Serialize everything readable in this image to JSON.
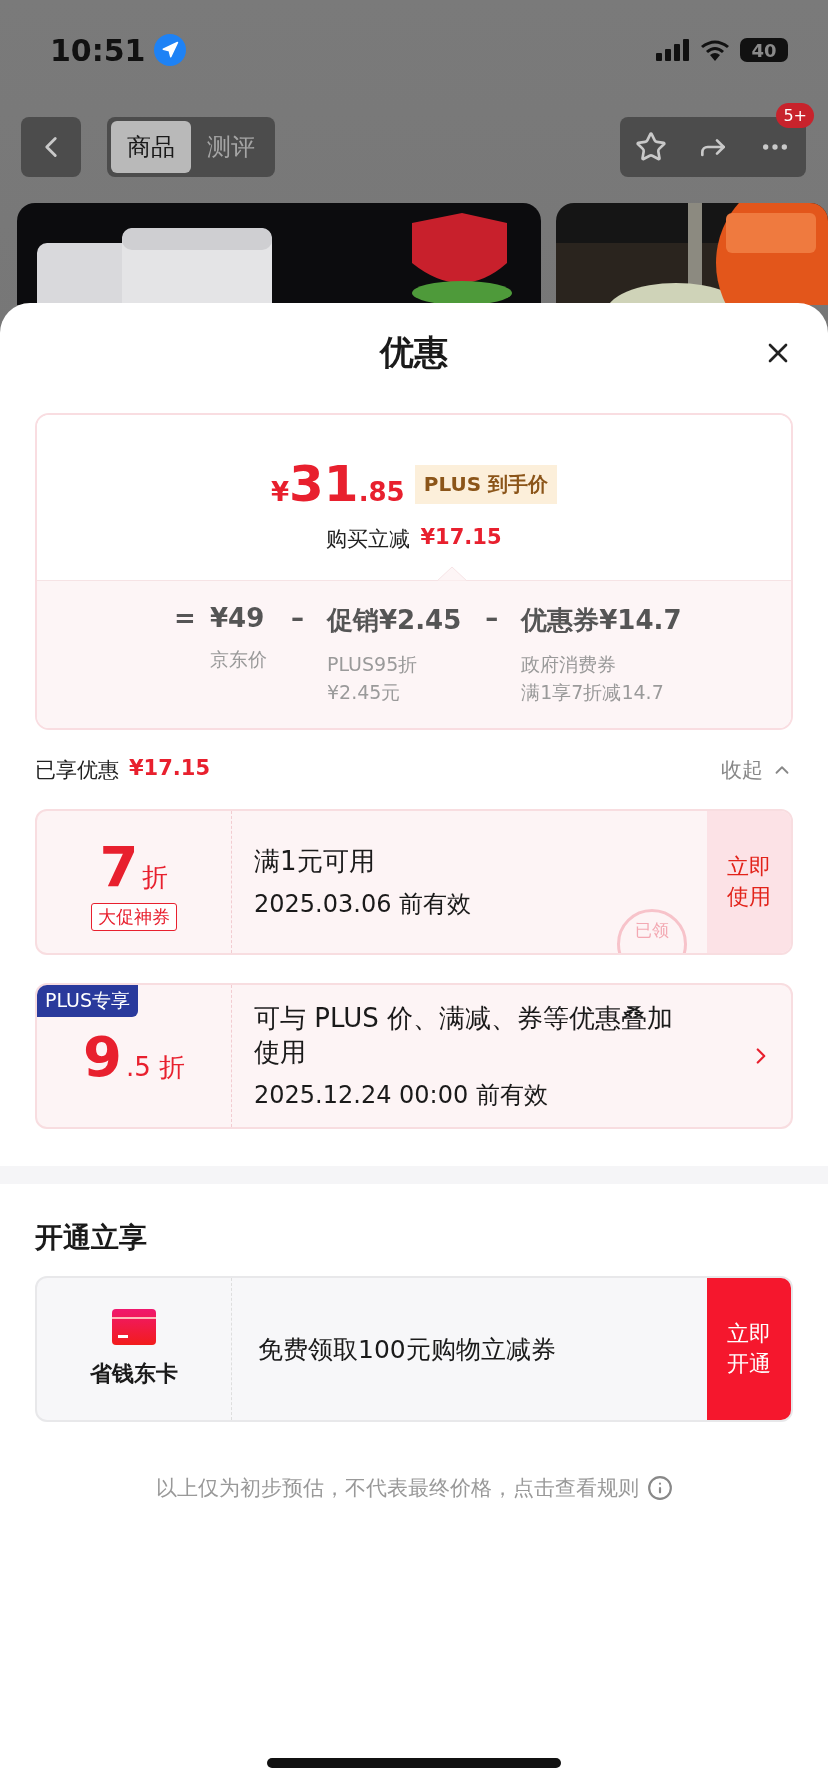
{
  "status_bar": {
    "time": "10:51",
    "battery": "40"
  },
  "nav": {
    "tabs": [
      {
        "label": "商品",
        "selected": true
      },
      {
        "label": "测评",
        "selected": false
      }
    ],
    "badge": "5+"
  },
  "sheet": {
    "title": "优惠"
  },
  "price": {
    "currency": "¥",
    "integer": "31",
    "decimal": ".85",
    "tag": "PLUS 到手价",
    "reduction_label": "购买立减",
    "reduction_value": "¥17.15",
    "breakdown": [
      {
        "op": "=",
        "amount": "¥49",
        "notes": [
          "京东价"
        ]
      },
      {
        "op": "–",
        "amount": "促销¥2.45",
        "notes": [
          "PLUS95折",
          "¥2.45元"
        ]
      },
      {
        "op": "–",
        "amount": "优惠券¥14.7",
        "notes": [
          "政府消费券",
          "满1享7折减14.7"
        ]
      }
    ]
  },
  "enjoyed": {
    "label": "已享优惠",
    "value": "¥17.15",
    "toggle": "收起",
    "expanded": true
  },
  "coupons": [
    {
      "kind": "discount",
      "big": "7",
      "small": "折",
      "tag": "大促神券",
      "title": "满1元可用",
      "validity": "2025.03.06 前有效",
      "action": "立即使用",
      "stamp": "已领"
    },
    {
      "kind": "plus",
      "ribbon": "PLUS专享",
      "big": "9",
      "small": ".5 折",
      "title": "可与 PLUS 价、满减、券等优惠叠加使用",
      "validity": "2025.12.24 00:00 前有效"
    }
  ],
  "membership": {
    "title": "开通立享",
    "name": "省钱东卡",
    "description": "免费领取100元购物立减券",
    "action": "立即开通"
  },
  "footnote": "以上仅为初步预估，不代表最终价格，点击查看规则"
}
